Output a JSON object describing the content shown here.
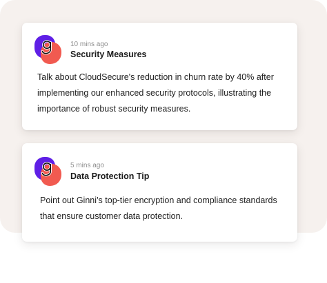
{
  "notifications": [
    {
      "avatar_icon": "ginni-logo-icon",
      "time": "10 mins ago",
      "title": "Security Measures",
      "body": "Talk about CloudSecure's reduction in churn rate by 40% after implementing our enhanced security protocols, illustrating the importance of robust security measures."
    },
    {
      "avatar_icon": "ginni-logo-icon",
      "time": "5 mins ago",
      "title": "Data Protection Tip",
      "body": "Point out Ginni’s top-tier encryption and compliance standards that ensure customer data protection."
    }
  ],
  "colors": {
    "brand_purple": "#5f1fe6",
    "brand_coral": "#f15a50",
    "backdrop": "#f6f1ee"
  }
}
